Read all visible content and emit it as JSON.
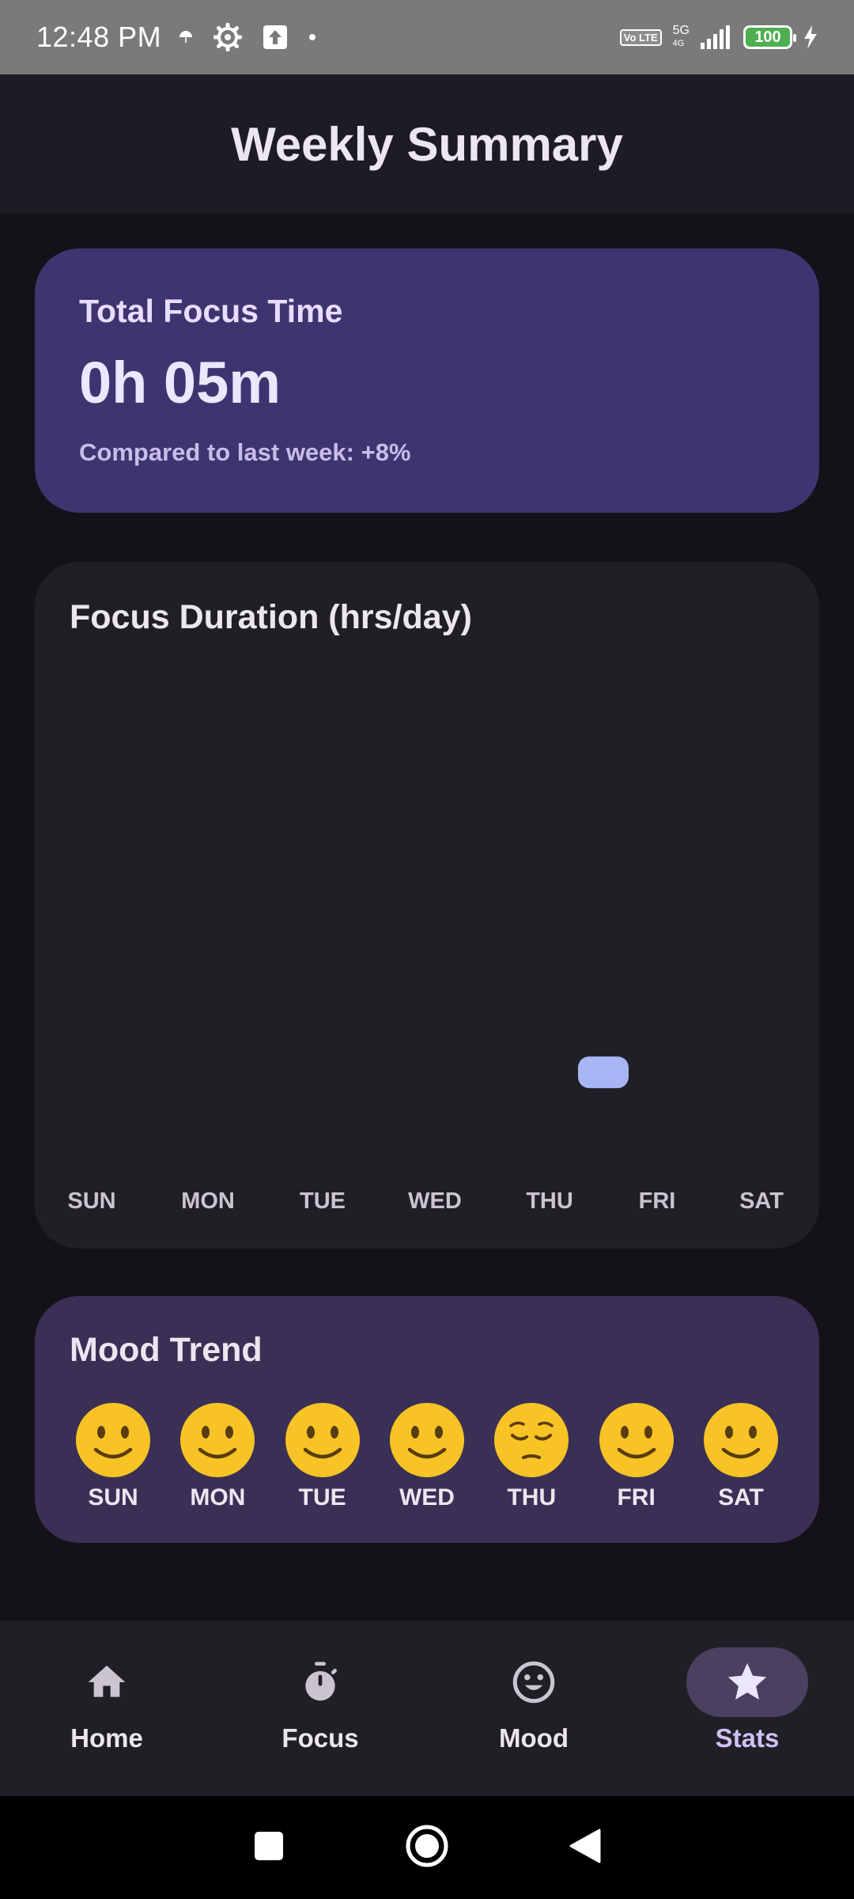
{
  "status_bar": {
    "time": "12:48 PM",
    "left_icons": [
      "umbrella-icon",
      "settings-gear-icon",
      "upload-icon",
      "dot-icon"
    ],
    "volte": "Vo LTE",
    "network": "5G",
    "network_sub": "4G",
    "battery": "100",
    "charging_icon": "bolt-icon"
  },
  "header": {
    "title": "Weekly Summary"
  },
  "total_focus": {
    "title": "Total Focus Time",
    "value": "0h 05m",
    "comparison": "Compared to last week: +8%"
  },
  "chart_data": {
    "type": "bar",
    "title": "Focus Duration (hrs/day)",
    "categories": [
      "SUN",
      "MON",
      "TUE",
      "WED",
      "THU",
      "FRI",
      "SAT"
    ],
    "values": [
      0,
      0,
      0,
      0,
      0.08,
      0,
      0
    ],
    "bar_color": "#a8b5f5",
    "grid": false
  },
  "mood_trend": {
    "title": "Mood Trend",
    "days": [
      {
        "label": "SUN",
        "mood": "slightly-smiling"
      },
      {
        "label": "MON",
        "mood": "slightly-smiling"
      },
      {
        "label": "TUE",
        "mood": "slightly-smiling"
      },
      {
        "label": "WED",
        "mood": "slightly-smiling"
      },
      {
        "label": "THU",
        "mood": "pensive"
      },
      {
        "label": "FRI",
        "mood": "slightly-smiling"
      },
      {
        "label": "SAT",
        "mood": "slightly-smiling"
      }
    ]
  },
  "bottom_nav": {
    "items": [
      {
        "label": "Home",
        "icon": "home-icon",
        "active": false
      },
      {
        "label": "Focus",
        "icon": "stopwatch-icon",
        "active": false
      },
      {
        "label": "Mood",
        "icon": "smiley-icon",
        "active": false
      },
      {
        "label": "Stats",
        "icon": "star-icon",
        "active": true
      }
    ]
  },
  "colors": {
    "background": "#141218",
    "total_card": "#3e3470",
    "chart_card": "#211f26",
    "mood_card": "#3a3055",
    "accent": "#cfc0f5"
  }
}
